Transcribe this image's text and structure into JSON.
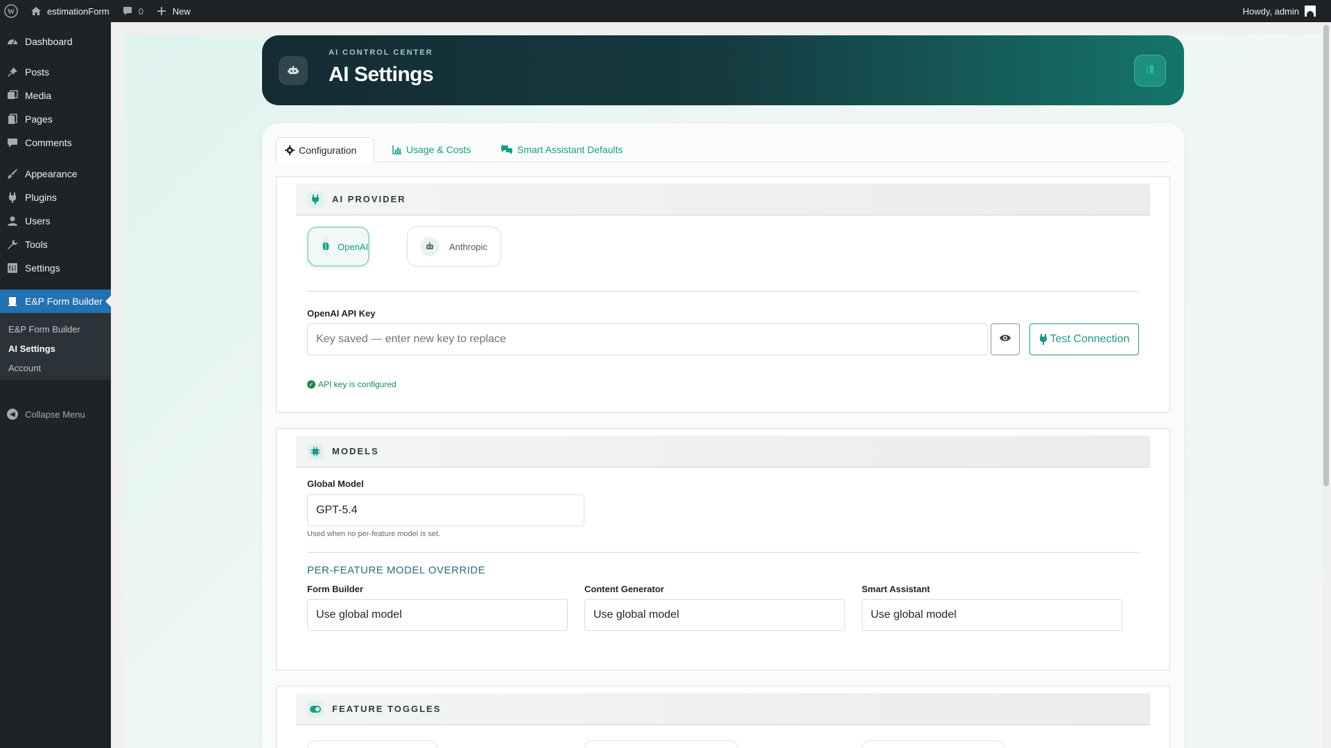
{
  "adminbar": {
    "site_name": "estimationForm",
    "comments_count": "0",
    "new_label": "New",
    "howdy": "Howdy, admin"
  },
  "sidebar": {
    "items": [
      {
        "label": "Dashboard",
        "icon": "dashboard-icon"
      },
      {
        "label": "Posts",
        "icon": "pin-icon"
      },
      {
        "label": "Media",
        "icon": "media-icon"
      },
      {
        "label": "Pages",
        "icon": "pages-icon"
      },
      {
        "label": "Comments",
        "icon": "comment-icon"
      },
      {
        "label": "Appearance",
        "icon": "brush-icon"
      },
      {
        "label": "Plugins",
        "icon": "plug-icon"
      },
      {
        "label": "Users",
        "icon": "user-icon"
      },
      {
        "label": "Tools",
        "icon": "wrench-icon"
      },
      {
        "label": "Settings",
        "icon": "settings-icon"
      },
      {
        "label": "E&P Form Builder",
        "icon": "form-builder-icon"
      }
    ],
    "submenu": [
      "E&P Form Builder",
      "AI Settings",
      "Account"
    ],
    "collapse_label": "Collapse Menu"
  },
  "header": {
    "kicker": "AI CONTROL CENTER",
    "title": "AI Settings"
  },
  "tabs": [
    {
      "label": "Configuration",
      "icon": "gear-icon"
    },
    {
      "label": "Usage & Costs",
      "icon": "chart-icon"
    },
    {
      "label": "Smart Assistant Defaults",
      "icon": "chat-icon"
    }
  ],
  "provider_section": {
    "title": "AI PROVIDER",
    "providers": [
      {
        "label": "OpenAI",
        "selected": true
      },
      {
        "label": "Anthropic",
        "selected": false
      }
    ],
    "api_key_label": "OpenAI API Key",
    "api_key_placeholder": "Key saved — enter new key to replace",
    "test_button": "Test Connection",
    "status": "API key is configured"
  },
  "models_section": {
    "title": "MODELS",
    "global_label": "Global Model",
    "global_value": "GPT-5.4",
    "global_help": "Used when no per-feature model is set.",
    "override_heading": "PER-FEATURE MODEL OVERRIDE",
    "overrides": [
      {
        "label": "Form Builder",
        "value": "Use global model"
      },
      {
        "label": "Content Generator",
        "value": "Use global model"
      },
      {
        "label": "Smart Assistant",
        "value": "Use global model"
      }
    ]
  },
  "toggles_section": {
    "title": "FEATURE TOGGLES"
  },
  "colors": {
    "accent": "#1a9a86",
    "admin_bar": "#1d2327",
    "active_menu": "#2271b1"
  }
}
